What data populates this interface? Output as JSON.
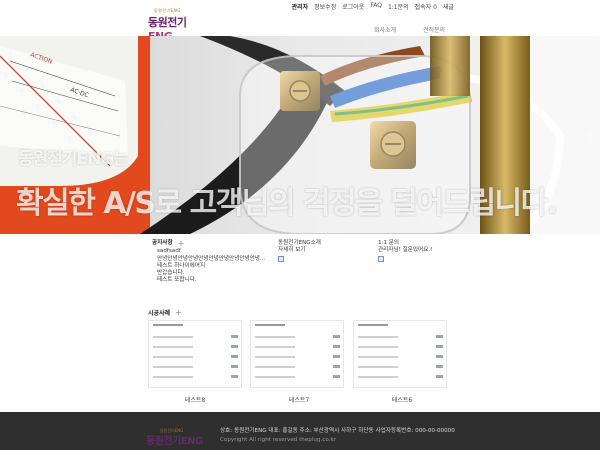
{
  "header": {
    "logo_small": "동원전기ENG",
    "logo_main": "동원전기",
    "logo_suffix": "ENG",
    "util_links": [
      "관리자",
      "정보수정",
      "로그아웃",
      "FAQ",
      "1:1문의",
      "접속자 0",
      "새글"
    ],
    "nav": [
      "회사소개",
      "견적문의"
    ]
  },
  "hero": {
    "caption_line1": "동원전기ENG는",
    "caption_line2": "확실한 A/S로 고객님의 걱정을 덜어드립니다.",
    "prev_arrow": "‹",
    "next_arrow": "›"
  },
  "notice": {
    "title": "공지사항",
    "plus": "+",
    "items": [
      "sadfsadf",
      "안녕안녕안녕안녕안녕안녕안녕안녕안녕안녕...",
      "테스트 하나이에어지",
      "반갑습니다.",
      "테스트 또합니다."
    ]
  },
  "about": {
    "title": "동원전기ENG소개",
    "line": "자세히 보기"
  },
  "qna": {
    "title": "1:1 문의",
    "line": "관리자님! 질문있어요.!"
  },
  "works": {
    "title": "시공사례",
    "plus": "+",
    "items": [
      {
        "label": "테스트8"
      },
      {
        "label": "테스트7"
      },
      {
        "label": "테스트6"
      }
    ]
  },
  "footer": {
    "logo_small": "동원전기ENG",
    "logo_main": "동원전기ENG",
    "info": "상호: 동원전기ENG  대표: 홍길동  주소: 부산광역시 사하구 하단동  사업자등록번호: 000-00-00000",
    "copyright": "Copyright All right reserved theplug.co.kr"
  },
  "colors": {
    "brand_purple": "#6a1d6e",
    "footer_bg": "#2f2f2f"
  }
}
